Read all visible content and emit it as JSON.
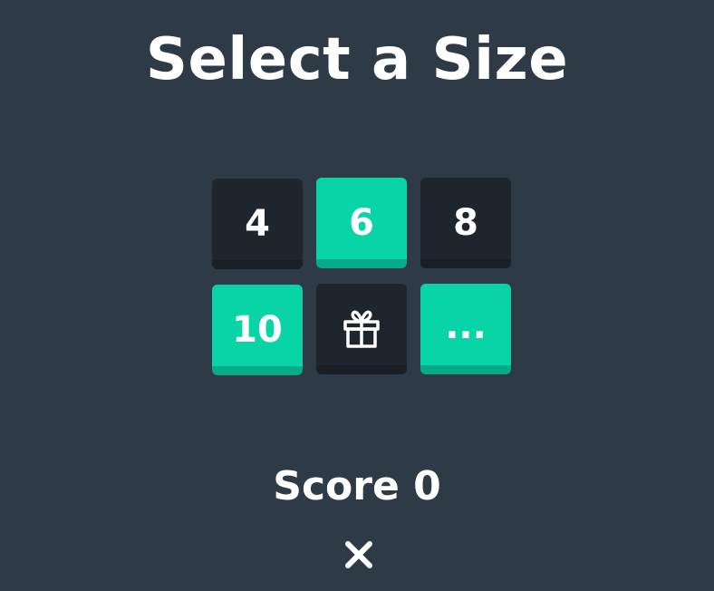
{
  "title": "Select a Size",
  "tiles": [
    {
      "label": "4",
      "style": "dark"
    },
    {
      "label": "6",
      "style": "teal"
    },
    {
      "label": "8",
      "style": "dark"
    },
    {
      "label": "10",
      "style": "teal"
    },
    {
      "label": "",
      "style": "dark",
      "icon": "gift-icon"
    },
    {
      "label": "...",
      "style": "teal"
    }
  ],
  "score": {
    "label": "Score 0"
  },
  "colors": {
    "background": "#2e3a46",
    "tile_dark": "#1e252c",
    "tile_teal": "#08d4a8",
    "text": "#ffffff"
  },
  "icons": {
    "gift": "gift-icon",
    "close": "close-icon"
  }
}
